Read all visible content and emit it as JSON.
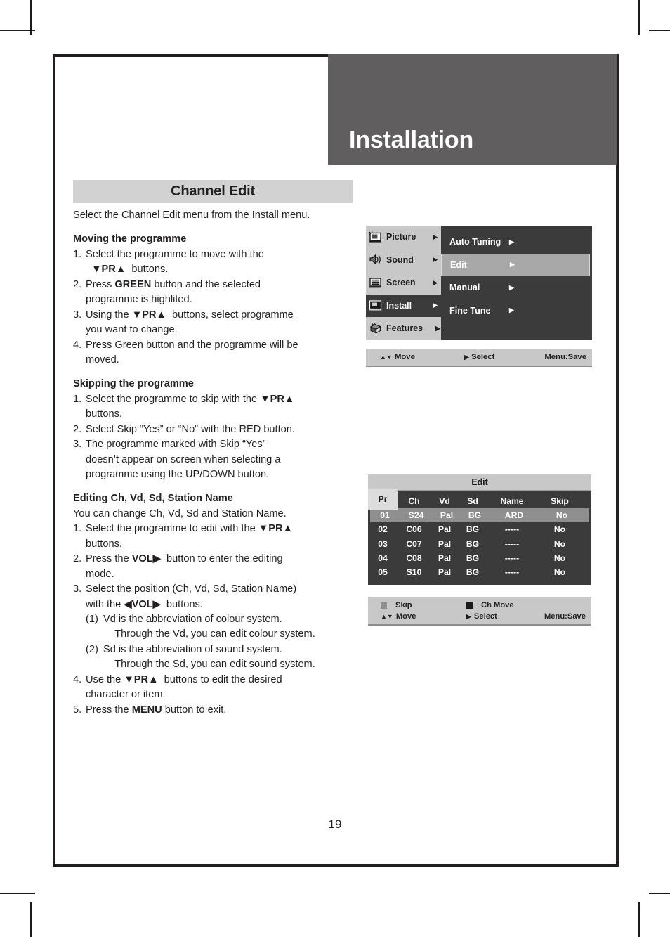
{
  "crop_marks": true,
  "header": {
    "title": "Installation"
  },
  "section": {
    "title": "Channel Edit"
  },
  "body": {
    "intro": "Select the Channel Edit menu from the Install menu.",
    "blocks": [
      {
        "heading": "Moving the programme",
        "items": [
          {
            "num": "1.",
            "lines": [
              "Select the programme to move with the",
              "▼PR▲ buttons."
            ]
          },
          {
            "num": "2.",
            "lines": [
              "Press GREEN button and the selected",
              "programme is highlited."
            ]
          },
          {
            "num": "3.",
            "lines": [
              "Using the ▼PR▲ buttons, select programme",
              "you want to change."
            ]
          },
          {
            "num": "4.",
            "lines": [
              "Press Green button and the programme will be",
              "moved."
            ]
          }
        ]
      },
      {
        "heading": "Skipping the programme",
        "items": [
          {
            "num": "1.",
            "lines": [
              "Select the programme to skip with the ▼PR▲",
              "buttons."
            ]
          },
          {
            "num": "2.",
            "lines": [
              "Select Skip “Yes” or “No” with the RED button."
            ]
          },
          {
            "num": "3.",
            "lines": [
              "The programme marked with Skip “Yes”",
              "doesn’t appear on screen when selecting a",
              "programme using the UP/DOWN button."
            ]
          }
        ]
      },
      {
        "heading": "Editing Ch, Vd, Sd, Station Name",
        "subtext": "You can change Ch, Vd, Sd and Station Name.",
        "items": [
          {
            "num": "1.",
            "lines": [
              "Select the programme to edit with the ▼PR▲",
              "buttons."
            ]
          },
          {
            "num": "2.",
            "lines": [
              "Press the VOL▶ button to enter the editing",
              "mode."
            ]
          },
          {
            "num": "3.",
            "lines": [
              "Select the position (Ch, Vd, Sd, Station Name)",
              "with the ◀VOL▶ buttons."
            ]
          },
          {
            "num": "(1)",
            "sub": true,
            "lines": [
              "Vd is the abbreviation of colour system.",
              "Through the Vd, you can edit colour system."
            ]
          },
          {
            "num": "(2)",
            "sub": true,
            "lines": [
              "Sd is the abbreviation of sound system.",
              "Through the Sd, you can edit sound system."
            ]
          },
          {
            "num": "4.",
            "lines": [
              "Use the ▼PR▲ buttons to edit the desired",
              "character or item."
            ]
          },
          {
            "num": "5.",
            "lines": [
              "Press the MENU button to exit."
            ]
          }
        ]
      }
    ]
  },
  "osd_menu": {
    "left_items": [
      {
        "label": "Picture",
        "icon": "picture-icon",
        "caret": "▶",
        "active": false
      },
      {
        "label": "Sound",
        "icon": "sound-icon",
        "caret": "▶",
        "active": false
      },
      {
        "label": "Screen",
        "icon": "screen-icon",
        "caret": "▶",
        "active": false
      },
      {
        "label": "Install",
        "icon": "install-icon",
        "caret": "▶",
        "active": true
      },
      {
        "label": "Features",
        "icon": "features-icon",
        "caret": "▶",
        "active": false
      }
    ],
    "right_items": [
      {
        "label": "Auto Tuning",
        "caret": "▶",
        "selected": false
      },
      {
        "label": "Edit",
        "caret": "▶",
        "selected": true
      },
      {
        "label": "Manual",
        "caret": "▶",
        "selected": false
      },
      {
        "label": "Fine Tune",
        "caret": "▶",
        "selected": false
      }
    ],
    "footer": {
      "move": "Move",
      "move_arrows": "▲▼",
      "select": "Select",
      "select_arrow": "▶",
      "save": "Menu:Save"
    }
  },
  "edit_screen": {
    "title": "Edit",
    "columns": [
      "Pr",
      "Ch",
      "Vd",
      "Sd",
      "Name",
      "Skip"
    ],
    "rows": [
      {
        "pr": "01",
        "ch": "S24",
        "vd": "Pal",
        "sd": "BG",
        "name": "ARD",
        "skip": "No",
        "selected": true
      },
      {
        "pr": "02",
        "ch": "C06",
        "vd": "Pal",
        "sd": "BG",
        "name": "-----",
        "skip": "No",
        "selected": false
      },
      {
        "pr": "03",
        "ch": "C07",
        "vd": "Pal",
        "sd": "BG",
        "name": "-----",
        "skip": "No",
        "selected": false
      },
      {
        "pr": "04",
        "ch": "C08",
        "vd": "Pal",
        "sd": "BG",
        "name": "-----",
        "skip": "No",
        "selected": false
      },
      {
        "pr": "05",
        "ch": "S10",
        "vd": "Pal",
        "sd": "BG",
        "name": "-----",
        "skip": "No",
        "selected": false
      }
    ],
    "footer": {
      "skip": "Skip",
      "ch_move": "Ch Move",
      "move": "Move",
      "move_arrows": "▲▼",
      "select": "Select",
      "select_arrow": "▶",
      "save": "Menu:Save"
    }
  },
  "page_number": "19",
  "colors": {
    "header_band": "#605e5e",
    "section_bar": "#d2d2d2",
    "osd_dark": "#3b3b3b",
    "osd_light": "#c8c8c8",
    "osd_highlight": "#a8a8a8",
    "row_highlight": "#8f8f8f",
    "frame": "#231f20"
  }
}
